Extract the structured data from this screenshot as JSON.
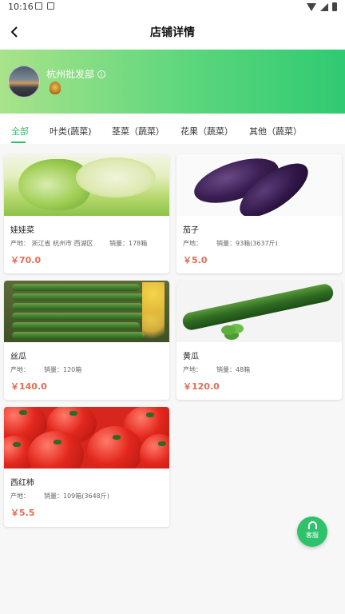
{
  "status_bar": {
    "time": "10:16"
  },
  "nav": {
    "title": "店铺详情"
  },
  "shop": {
    "name": "杭州批发部"
  },
  "tabs": [
    {
      "label": "全部"
    },
    {
      "label": "叶类(蔬菜)"
    },
    {
      "label": "茎菜（蔬菜）"
    },
    {
      "label": "花果（蔬菜）"
    },
    {
      "label": "其他（蔬菜）"
    }
  ],
  "products": [
    {
      "name": "娃娃菜",
      "origin": "产地：  浙江省 杭州市 西湖区",
      "sales": "销量：178箱",
      "price": "￥70.0"
    },
    {
      "name": "茄子",
      "origin": "产地：",
      "sales": "销量：93箱(3637斤)",
      "price": "￥5.0"
    },
    {
      "name": "丝瓜",
      "origin": "产地：",
      "sales": "销量：120箱",
      "price": "￥140.0"
    },
    {
      "name": "黄瓜",
      "origin": "产地：",
      "sales": "销量：48箱",
      "price": "￥120.0"
    },
    {
      "name": "西红柿",
      "origin": "产地：",
      "sales": "销量：109箱(3648斤)",
      "price": "￥5.5"
    }
  ],
  "customer_service": {
    "label": "客服"
  },
  "colors": {
    "accent": "#2fbf6a",
    "price": "#e46c52"
  }
}
